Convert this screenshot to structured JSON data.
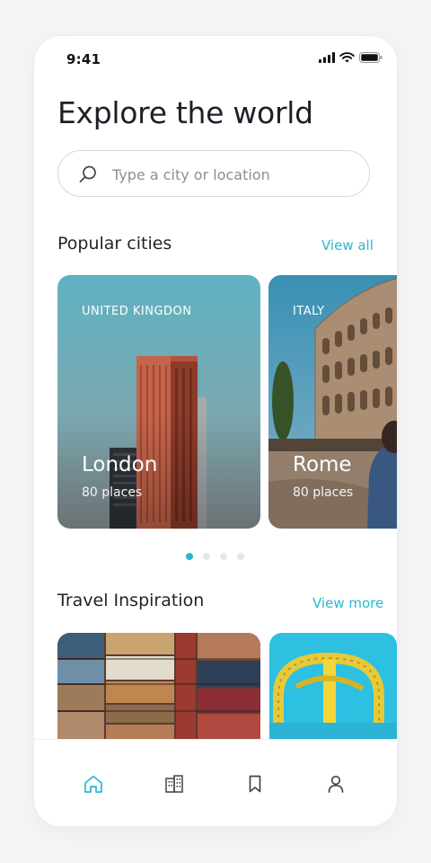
{
  "status_bar": {
    "time": "9:41"
  },
  "header": {
    "title": "Explore the world"
  },
  "search": {
    "placeholder": "Type a city or location"
  },
  "popular": {
    "title": "Popular cities",
    "link": "View all",
    "cards": [
      {
        "country": "UNITED KINGDON",
        "city": "London",
        "places": "80 places"
      },
      {
        "country": "ITALY",
        "city": "Rome",
        "places": "80 places"
      }
    ],
    "pagination": {
      "total": 4,
      "active_index": 0
    }
  },
  "inspiration": {
    "title": "Travel Inspiration",
    "link": "View more",
    "cards": [
      {
        "subject": "suitcases"
      },
      {
        "subject": "roller-coaster"
      }
    ]
  },
  "tabbar": {
    "items": [
      {
        "icon": "home-icon",
        "active": true
      },
      {
        "icon": "buildings-icon",
        "active": false
      },
      {
        "icon": "bookmark-icon",
        "active": false
      },
      {
        "icon": "user-icon",
        "active": false
      }
    ]
  },
  "colors": {
    "accent": "#2bb8cf",
    "text": "#1f2329",
    "muted": "#8a8f94"
  }
}
